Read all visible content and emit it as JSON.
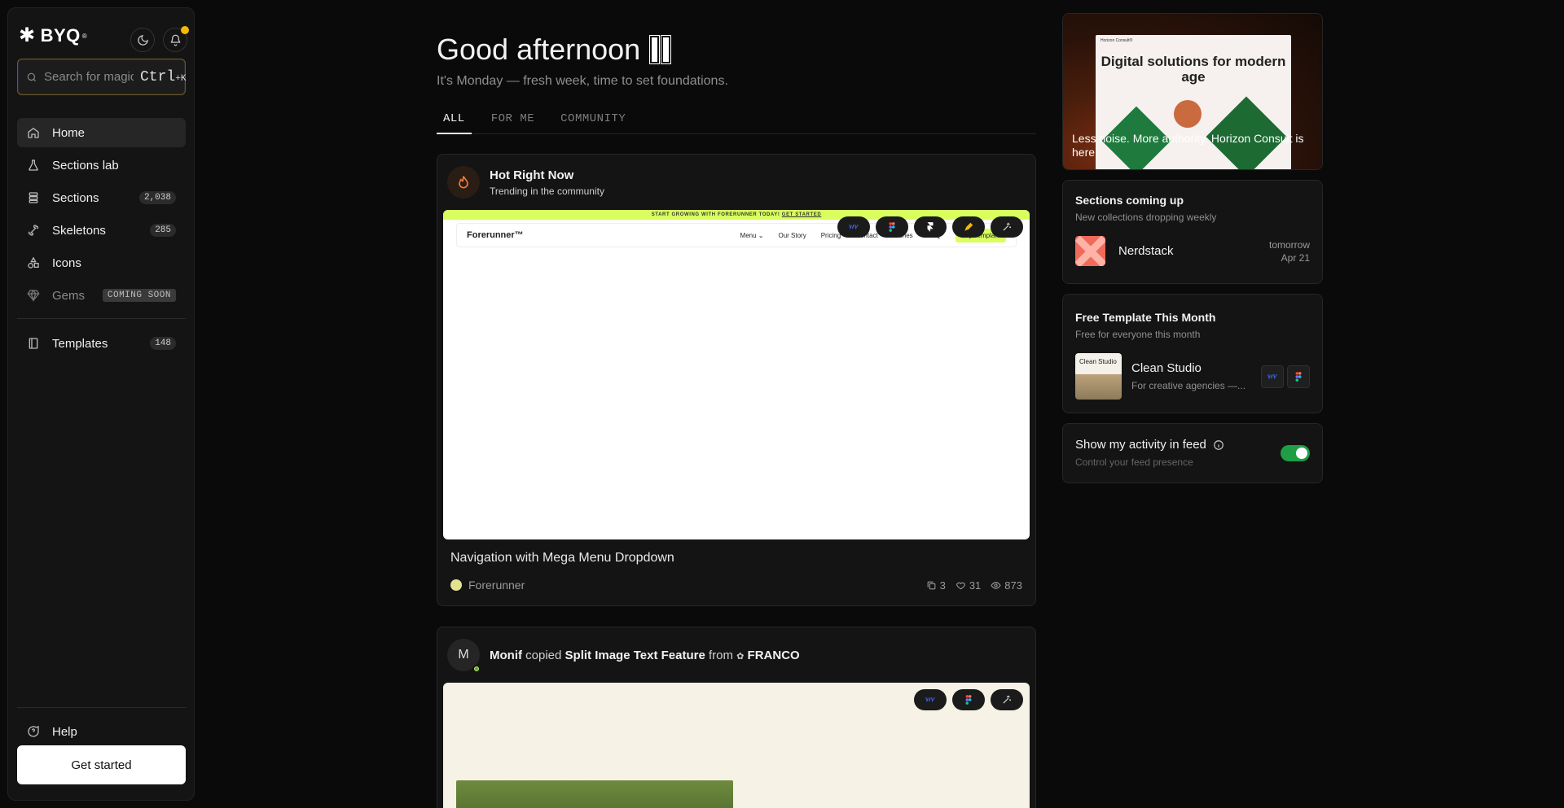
{
  "brand": {
    "name": "BYQ",
    "mark": "®"
  },
  "search": {
    "placeholder": "Search for magic",
    "shortcut_key": "Ctrl",
    "shortcut_suffix": "+K"
  },
  "nav": {
    "items": [
      {
        "label": "Home",
        "active": true
      },
      {
        "label": "Sections lab"
      },
      {
        "label": "Sections",
        "count": "2,038"
      },
      {
        "label": "Skeletons",
        "count": "285"
      },
      {
        "label": "Icons"
      },
      {
        "label": "Gems",
        "badge": "COMING SOON"
      }
    ],
    "templates": {
      "label": "Templates",
      "count": "148"
    },
    "help": "Help",
    "cta": "Get started"
  },
  "main": {
    "greeting": "Good afternoon",
    "subtitle": "It's Monday — fresh week, time to set foundations.",
    "tabs": [
      "ALL",
      "FOR ME",
      "COMMUNITY"
    ]
  },
  "feed": [
    {
      "head_title": "Hot Right Now",
      "head_sub": "Trending in the community",
      "site": {
        "banner": "START GROWING WITH FORERUNNER TODAY!",
        "banner_link": "GET STARTED",
        "logo": "Forerunner™",
        "links": [
          "Menu ⌄",
          "Our Story",
          "Pricing",
          "Contact",
          "Stories",
          "FAQ"
        ],
        "cta": "Buy Template"
      },
      "title": "Navigation with Mega Menu Dropdown",
      "author": "Forerunner",
      "copies": "3",
      "likes": "31",
      "views": "873"
    },
    {
      "avatar_initial": "M",
      "actor": "Monif",
      "verb": "copied",
      "item": "Split Image Text Feature",
      "prep": "from",
      "source": "FRANCO"
    }
  ],
  "right": {
    "hero": {
      "doc_brand": "Horizon Consult®",
      "doc_title": "Digital solutions for modern age",
      "caption": "Less noise. More authority. Horizon Consult is here"
    },
    "coming": {
      "title": "Sections coming up",
      "sub": "New collections dropping weekly",
      "item_name": "Nerdstack",
      "item_when": "tomorrow",
      "item_date": "Apr 21"
    },
    "free_template": {
      "title": "Free Template This Month",
      "sub": "Free for everyone this month",
      "thumb_label": "Clean Studio",
      "name": "Clean Studio",
      "desc": "For creative agencies —..."
    },
    "activity": {
      "title": "Show my activity in feed",
      "sub": "Control your feed presence",
      "enabled": true
    }
  },
  "colors": {
    "accent_green": "#1f9e45",
    "banner_lime": "#d8ff5e",
    "notify_yellow": "#f5b800"
  }
}
